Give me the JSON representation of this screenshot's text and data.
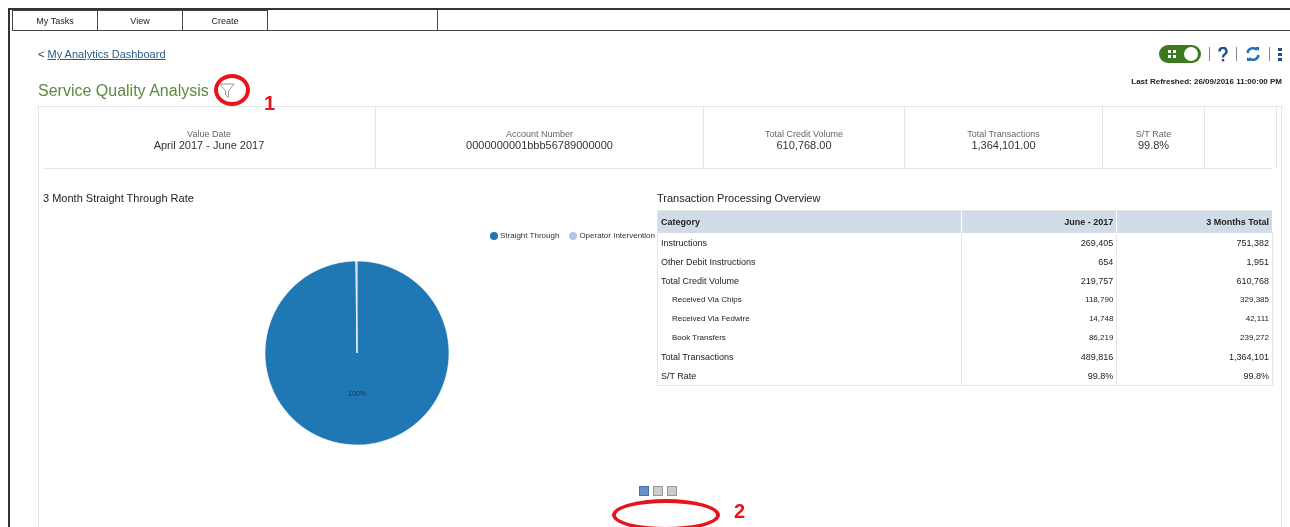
{
  "menu_tabs": [
    {
      "label": "My Tasks"
    },
    {
      "label": "View"
    },
    {
      "label": "Create"
    }
  ],
  "breadcrumb": {
    "prefix": "<",
    "link": "My Analytics Dashboard"
  },
  "title": "Service Quality Analysis",
  "toolbar": {
    "toggle_on": true
  },
  "last_refreshed": "Last Refreshed: 26/09/2016 11:00:00 PM",
  "summary": [
    {
      "label": "Value Date",
      "value": "April 2017 - June 2017"
    },
    {
      "label": "Account Number",
      "value": "0000000001bbb56789000000"
    },
    {
      "label": "Total Credit Volume",
      "value": "610,768.00"
    },
    {
      "label": "Total Transactions",
      "value": "1,364,101.00"
    },
    {
      "label": "S/T Rate",
      "value": "99.8%"
    }
  ],
  "pie_panel": {
    "title": "3 Month Straight Through Rate",
    "chart_data": {
      "type": "pie",
      "categories": [
        "Straight Through",
        "Operator Intervention"
      ],
      "values": [
        99.8,
        0.2
      ],
      "colors": [
        "#1f77b4",
        "#aec7e8"
      ],
      "value_labels": [
        "100%",
        null
      ]
    }
  },
  "table": {
    "title": "Transaction Processing Overview",
    "columns": [
      "Category",
      "June - 2017",
      "3 Months Total"
    ],
    "rows": [
      {
        "cells": [
          "Instructions",
          "269,405",
          "751,382"
        ],
        "sub": false
      },
      {
        "cells": [
          "Other Debit Instructions",
          "654",
          "1,951"
        ],
        "sub": false
      },
      {
        "cells": [
          "Total Credit Volume",
          "219,757",
          "610,768"
        ],
        "sub": false
      },
      {
        "cells": [
          "Received Via Chips",
          "118,790",
          "329,385"
        ],
        "sub": true
      },
      {
        "cells": [
          "Received Via Fedwire",
          "14,748",
          "42,111"
        ],
        "sub": true
      },
      {
        "cells": [
          "Book Transfers",
          "86,219",
          "239,272"
        ],
        "sub": true
      },
      {
        "cells": [
          "Total Transactions",
          "489,816",
          "1,364,101"
        ],
        "sub": false
      },
      {
        "cells": [
          "S/T Rate",
          "99.8%",
          "99.8%"
        ],
        "sub": false
      }
    ]
  },
  "pages": [
    {
      "selected": true
    },
    {
      "selected": false
    },
    {
      "selected": false
    }
  ],
  "annotations": [
    "1",
    "2"
  ]
}
